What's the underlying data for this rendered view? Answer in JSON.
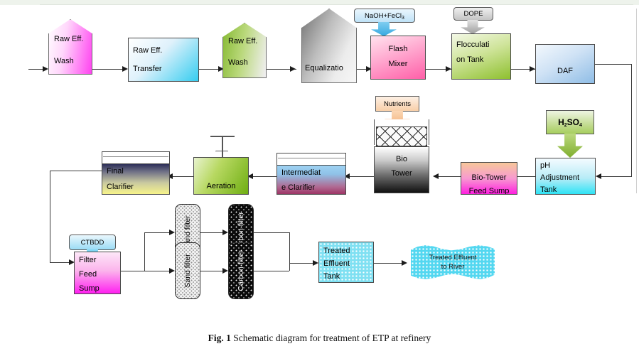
{
  "figure": {
    "label": "Fig. 1",
    "caption": "Schematic diagram for treatment of ETP at refinery"
  },
  "row1": {
    "raw_eff_wash_1": {
      "line1": "Raw Eff.",
      "line2": "Wash"
    },
    "raw_eff_transfer": {
      "line1": "Raw Eff.",
      "line2": "Transfer"
    },
    "raw_eff_wash_2": {
      "line1": "Raw Eff.",
      "line2": "Wash"
    },
    "equalization": {
      "line1": "Equalizatio"
    },
    "flash_mixer": {
      "line1": "Flash",
      "line2": "Mixer"
    },
    "flocculation_tank": {
      "line1": "Flocculati",
      "line2": "on Tank"
    },
    "daf": {
      "line1": "DAF"
    }
  },
  "row2": {
    "final_clarifier": {
      "line1": "Final",
      "line2": "Clarifier"
    },
    "aeration": {
      "line1": "Aeration"
    },
    "intermediate_clarifier": {
      "line1": "Intermediat",
      "line2": "e Clarifier"
    },
    "bio_tower": {
      "line1": "Bio",
      "line2": "Tower"
    },
    "bio_tower_feed_sump": {
      "line1": "Bio-Tower",
      "line2": "Feed Sump"
    },
    "ph_adjustment_tank": {
      "line1": "pH",
      "line2": "Adjustment",
      "line3": "Tank"
    }
  },
  "row3": {
    "filter_feed_sump": {
      "line1": "Filter",
      "line2": "Feed",
      "line3": "Sump"
    },
    "sand_filter_1": {
      "label": "Sand filter"
    },
    "sand_filter_2": {
      "label": "Sand filter"
    },
    "carbon_filter_1": {
      "label": "Carbon filter"
    },
    "carbon_filter_2": {
      "label": "Carbon filter"
    },
    "treated_effluent_tank": {
      "line1": "Treated",
      "line2": "Effluent",
      "line3": "Tank"
    },
    "river": {
      "line1": "Treated Effluent",
      "line2": "to   River"
    }
  },
  "chemicals": {
    "naoh_fecl3_prefix": "NaOH+FeCl",
    "naoh_fecl3_sub": "3",
    "dope": "DOPE",
    "nutrients": "Nutrients",
    "h2so4_h": "H",
    "h2so4_sub1": "2",
    "h2so4_s": "SO",
    "h2so4_sub2": "4",
    "ctbdd": "CTBDD"
  },
  "colors": {
    "magenta": "#ff3ff0",
    "cyan": "#35cdf0",
    "green": "#84b830",
    "gray": "#9a9a9a",
    "pink": "#ff7fbf",
    "lightblue": "#a8cdee",
    "yellow": "#f5f08a",
    "navy": "#2d2f57",
    "orange": "#f5b27a",
    "black": "#111111"
  }
}
